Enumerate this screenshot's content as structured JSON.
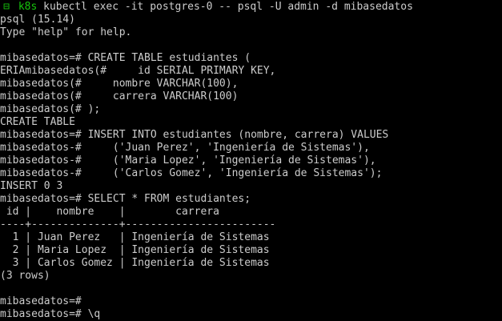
{
  "prompt": {
    "icon": "⊟",
    "context": "k8s",
    "command": "kubectl exec -it postgres-0 -- psql -U admin -d mibasedatos"
  },
  "lines": [
    "psql (15.14)",
    "Type \"help\" for help.",
    "",
    "mibasedatos=# CREATE TABLE estudiantes (",
    "ERIAmibasedatos(#     id SERIAL PRIMARY KEY,",
    "mibasedatos(#     nombre VARCHAR(100),",
    "mibasedatos(#     carrera VARCHAR(100)",
    "mibasedatos(# );",
    "CREATE TABLE",
    "mibasedatos=# INSERT INTO estudiantes (nombre, carrera) VALUES",
    "mibasedatos-#     ('Juan Perez', 'Ingeniería de Sistemas'),",
    "mibasedatos-#     ('Maria Lopez', 'Ingeniería de Sistemas'),",
    "mibasedatos-#     ('Carlos Gomez', 'Ingeniería de Sistemas');",
    "INSERT 0 3",
    "mibasedatos=# SELECT * FROM estudiantes;",
    " id |    nombre    |        carrera",
    "----+--------------+------------------------",
    "  1 | Juan Perez   | Ingeniería de Sistemas",
    "  2 | Maria Lopez  | Ingeniería de Sistemas",
    "  3 | Carlos Gomez | Ingeniería de Sistemas",
    "(3 rows)",
    "",
    "mibasedatos=#",
    "mibasedatos=# \\q"
  ],
  "colors": {
    "background": "#000000",
    "foreground": "#cccccc",
    "prompt_green": "#16c60c"
  }
}
